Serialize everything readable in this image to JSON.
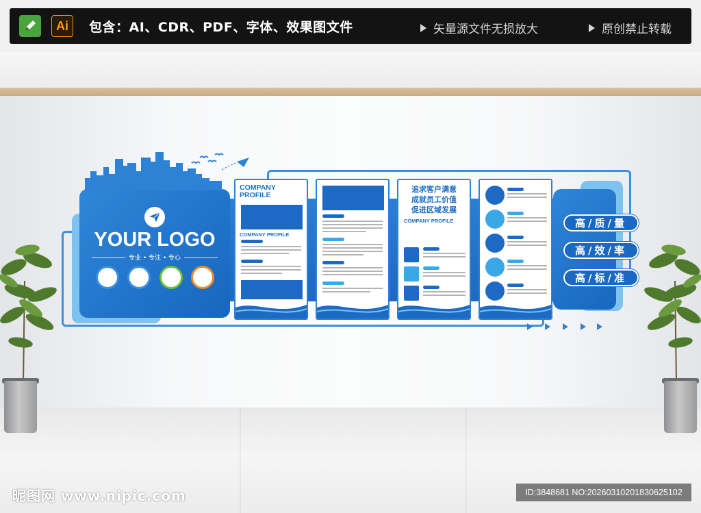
{
  "banner": {
    "app_icons": [
      "pen-icon",
      "illustrator-icon"
    ],
    "ai_label": "Ai",
    "formats_text": "包含：AI、CDR、PDF、字体、效果图文件",
    "note_vector": "矢量源文件无损放大",
    "note_original": "原创禁止转载"
  },
  "logo_panel": {
    "logo_text": "YOUR LOGO",
    "slogan": "专业 • 专注 • 专心",
    "ring_colors": [
      "#3b8fe0",
      "#3b8fe0",
      "#6fbf3d",
      "#f08a2c"
    ]
  },
  "panels": {
    "panel1": {
      "title": "COMPANY PROFILE",
      "subtitle": "COMPANY PROFILE"
    },
    "panel3": {
      "heading_lines": [
        "追求客户满意",
        "成就员工价值",
        "促进区域发展"
      ],
      "subtitle": "COMPANY PROFILE"
    }
  },
  "labels": [
    "高/质/量",
    "高/效/率",
    "高/标/准"
  ],
  "colors": {
    "primary_blue": "#1c6ac3",
    "light_blue": "#7ec2f0",
    "accent_cyan": "#3aa8e6"
  },
  "watermark": {
    "site": "昵图网 www.nipic.com",
    "id_text": "ID:3848681 NO:20260310201830625102"
  }
}
